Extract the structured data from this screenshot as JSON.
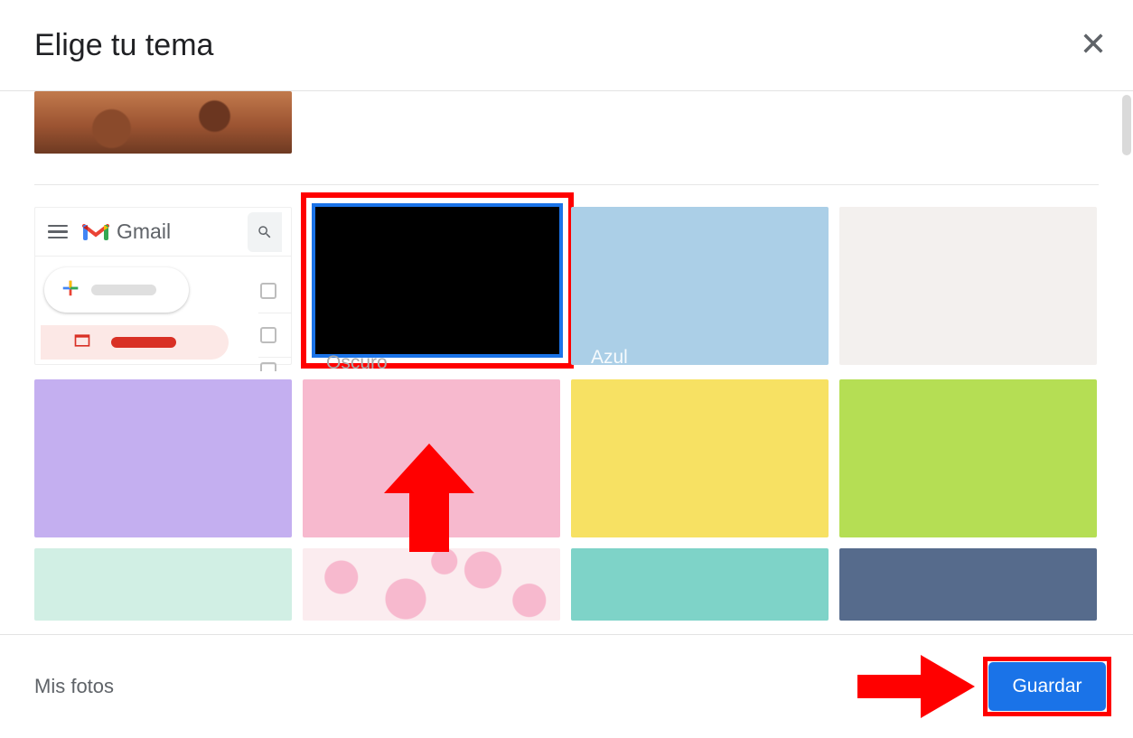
{
  "header": {
    "title": "Elige tu tema"
  },
  "preview": {
    "brand": "Gmail"
  },
  "themes": {
    "dark_label": "Oscuro",
    "blue_label": "Azul"
  },
  "footer": {
    "my_photos": "Mis fotos",
    "save": "Guardar"
  }
}
